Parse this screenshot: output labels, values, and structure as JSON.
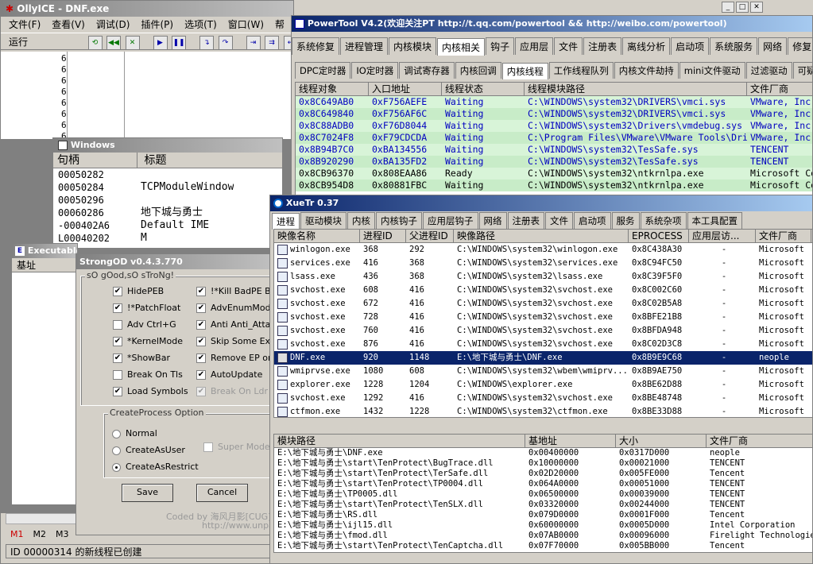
{
  "olly": {
    "title": "OllyICE - DNF.exe",
    "menu": [
      "文件(F)",
      "查看(V)",
      "调试(D)",
      "插件(P)",
      "选项(T)",
      "窗口(W)",
      "帮"
    ],
    "run_label": "运行",
    "side_chars": [
      "6",
      "6",
      "6",
      "6",
      "6",
      "6",
      "6",
      "6"
    ],
    "status_mtabs": [
      "M1",
      "M2",
      "M3"
    ],
    "status": "ID 00000314 的新线程已创建"
  },
  "windows": {
    "title": "Windows",
    "col_handle": "句柄",
    "col_title": "标题",
    "rows": [
      {
        "h": "00050282",
        "t": ""
      },
      {
        "h": "00050284",
        "t": "TCPModuleWindow"
      },
      {
        "h": "00050296",
        "t": ""
      },
      {
        "h": "00060286",
        "t": "地下城与勇士"
      },
      {
        "h": "-000402A6",
        "t": "Default IME"
      },
      {
        "h": "L00040202",
        "t": "M"
      }
    ]
  },
  "exec": {
    "title": "Executable modules",
    "col_base": "基址"
  },
  "strongod": {
    "title": "StrongOD v0.4.3.770",
    "group": "sO gOod,sO sTroNg!",
    "left": [
      {
        "label": "HidePEB",
        "checked": true
      },
      {
        "label": "!*PatchFloat",
        "checked": true
      },
      {
        "label": "Adv Ctrl+G",
        "checked": false
      },
      {
        "label": "*KernelMode",
        "checked": true
      },
      {
        "label": "*ShowBar",
        "checked": true
      },
      {
        "label": "Break On Tls",
        "checked": false
      },
      {
        "label": "Load Symbols",
        "checked": true
      }
    ],
    "right": [
      {
        "label": "!*Kill BadPE Bug",
        "checked": true
      },
      {
        "label": "AdvEnumModule",
        "checked": true
      },
      {
        "label": "Anti Anti_Attach",
        "checked": true
      },
      {
        "label": "Skip Some Exce",
        "checked": true
      },
      {
        "label": "Remove EP one",
        "checked": true
      },
      {
        "label": "AutoUpdate",
        "checked": true
      },
      {
        "label": "Break On Ldr",
        "checked": true
      }
    ],
    "cp_group": "CreateProcess Option",
    "radios": [
      {
        "label": "Normal",
        "on": false
      },
      {
        "label": "CreateAsUser",
        "on": false
      },
      {
        "label": "CreateAsRestrict",
        "on": true
      }
    ],
    "super_mode": "Super Mode",
    "save": "Save",
    "cancel": "Cancel",
    "coded": "Coded by 海风月影[CUG]",
    "url": "http://www.unpa"
  },
  "powertool": {
    "title": "PowerTool V4.2(欢迎关注PT http://t.qq.com/powertool && http://weibo.com/powertool)",
    "tabs1": [
      "系统修复",
      "进程管理",
      "内核模块",
      "内核相关",
      "钩子",
      "应用层",
      "文件",
      "注册表",
      "离线分析",
      "启动项",
      "系统服务",
      "网络",
      "修复"
    ],
    "tabs1_sel": 3,
    "tabs2": [
      "DPC定时器",
      "IO定时器",
      "调试寄存器",
      "内核回调",
      "内核线程",
      "工作线程队列",
      "内核文件劫持",
      "mini文件驱动",
      "过滤驱动",
      "可疑"
    ],
    "tabs2_sel": 4,
    "cols": [
      "线程对象",
      "入口地址",
      "线程状态",
      "线程模块路径",
      "文件厂商"
    ],
    "rows": [
      [
        "0x8C649AB0",
        "0xF756AEFE",
        "Waiting",
        "C:\\WINDOWS\\system32\\DRIVERS\\vmci.sys",
        "VMware, Inc."
      ],
      [
        "0x8C649840",
        "0xF756AF6C",
        "Waiting",
        "C:\\WINDOWS\\system32\\DRIVERS\\vmci.sys",
        "VMware, Inc."
      ],
      [
        "0x8C88ADB0",
        "0xF76D8044",
        "Waiting",
        "C:\\WINDOWS\\system32\\Drivers\\vmdebug.sys",
        "VMware, Inc."
      ],
      [
        "0x8C7024F8",
        "0xF79CDCDA",
        "Waiting",
        "C:\\Program Files\\VMware\\VMware Tools\\Driver...",
        "VMware, Inc."
      ],
      [
        "0x8B94B7C0",
        "0xBA134556",
        "Waiting",
        "C:\\WINDOWS\\system32\\TesSafe.sys",
        "TENCENT"
      ],
      [
        "0x8B920290",
        "0xBA135FD2",
        "Waiting",
        "C:\\WINDOWS\\system32\\TesSafe.sys",
        "TENCENT"
      ],
      [
        "0x8CB96370",
        "0x808EAA86",
        "Ready",
        "C:\\WINDOWS\\system32\\ntkrnlpa.exe",
        "Microsoft Corp"
      ],
      [
        "0x8CB954D8",
        "0x80881FBC",
        "Waiting",
        "C:\\WINDOWS\\system32\\ntkrnlpa.exe",
        "Microsoft Corp"
      ]
    ]
  },
  "xuetr": {
    "title": "XueTr 0.37",
    "tabs": [
      "进程",
      "驱动模块",
      "内核",
      "内核钩子",
      "应用层钩子",
      "网络",
      "注册表",
      "文件",
      "启动项",
      "服务",
      "系统杂项",
      "本工具配置"
    ],
    "tabs_sel": 0,
    "cols": [
      "映像名称",
      "进程ID",
      "父进程ID",
      "映像路径",
      "EPROCESS",
      "应用层访...",
      "文件厂商"
    ],
    "rows": [
      [
        "winlogon.exe",
        "368",
        "292",
        "C:\\WINDOWS\\system32\\winlogon.exe",
        "0x8C438A30",
        "-",
        "Microsoft"
      ],
      [
        "services.exe",
        "416",
        "368",
        "C:\\WINDOWS\\system32\\services.exe",
        "0x8C94FC50",
        "-",
        "Microsoft"
      ],
      [
        "lsass.exe",
        "436",
        "368",
        "C:\\WINDOWS\\system32\\lsass.exe",
        "0x8C39F5F0",
        "-",
        "Microsoft"
      ],
      [
        "svchost.exe",
        "608",
        "416",
        "C:\\WINDOWS\\system32\\svchost.exe",
        "0x8C002C60",
        "-",
        "Microsoft"
      ],
      [
        "svchost.exe",
        "672",
        "416",
        "C:\\WINDOWS\\system32\\svchost.exe",
        "0x8C02B5A8",
        "-",
        "Microsoft"
      ],
      [
        "svchost.exe",
        "728",
        "416",
        "C:\\WINDOWS\\system32\\svchost.exe",
        "0x8BFE21B8",
        "-",
        "Microsoft"
      ],
      [
        "svchost.exe",
        "760",
        "416",
        "C:\\WINDOWS\\system32\\svchost.exe",
        "0x8BFDA948",
        "-",
        "Microsoft"
      ],
      [
        "svchost.exe",
        "876",
        "416",
        "C:\\WINDOWS\\system32\\svchost.exe",
        "0x8C02D3C8",
        "-",
        "Microsoft"
      ],
      [
        "DNF.exe",
        "920",
        "1148",
        "E:\\地下城与勇士\\DNF.exe",
        "0x8B9E9C68",
        "-",
        "neople"
      ],
      [
        "wmiprvse.exe",
        "1080",
        "608",
        "C:\\WINDOWS\\system32\\wbem\\wmiprv...",
        "0x8B9AE750",
        "-",
        "Microsoft"
      ],
      [
        "explorer.exe",
        "1228",
        "1204",
        "C:\\WINDOWS\\explorer.exe",
        "0x8BE62D88",
        "-",
        "Microsoft"
      ],
      [
        "svchost.exe",
        "1292",
        "416",
        "C:\\WINDOWS\\system32\\svchost.exe",
        "0x8BE48748",
        "-",
        "Microsoft"
      ],
      [
        "ctfmon.exe",
        "1432",
        "1228",
        "C:\\WINDOWS\\system32\\ctfmon.exe",
        "0x8BE33D88",
        "-",
        "Microsoft"
      ]
    ],
    "selected_row": 8,
    "mcols": [
      "模块路径",
      "基地址",
      "大小",
      "文件厂商"
    ],
    "mrows": [
      [
        "E:\\地下城与勇士\\DNF.exe",
        "0x00400000",
        "0x0317D000",
        "neople"
      ],
      [
        "E:\\地下城与勇士\\start\\TenProtect\\BugTrace.dll",
        "0x10000000",
        "0x00021000",
        "TENCENT"
      ],
      [
        "E:\\地下城与勇士\\start\\TenProtect\\TerSafe.dll",
        "0x02D20000",
        "0x005FE000",
        "Tencent"
      ],
      [
        "E:\\地下城与勇士\\start\\TenProtect\\TP0004.dll",
        "0x064A0000",
        "0x00051000",
        "TENCENT"
      ],
      [
        "E:\\地下城与勇士\\TP0005.dll",
        "0x06500000",
        "0x00039000",
        "TENCENT"
      ],
      [
        "E:\\地下城与勇士\\start\\TenProtect\\TenSLX.dll",
        "0x03320000",
        "0x00244000",
        "TENCENT"
      ],
      [
        "E:\\地下城与勇士\\RS.dll",
        "0x079D0000",
        "0x0001F000",
        "Tencent"
      ],
      [
        "E:\\地下城与勇士\\ijl15.dll",
        "0x60000000",
        "0x0005D000",
        "Intel Corporation"
      ],
      [
        "E:\\地下城与勇士\\fmod.dll",
        "0x07AB0000",
        "0x00096000",
        "Firelight Technologies"
      ],
      [
        "E:\\地下城与勇士\\start\\TenProtect\\TenCaptcha.dll",
        "0x07F70000",
        "0x005BB000",
        "Tencent"
      ]
    ]
  }
}
